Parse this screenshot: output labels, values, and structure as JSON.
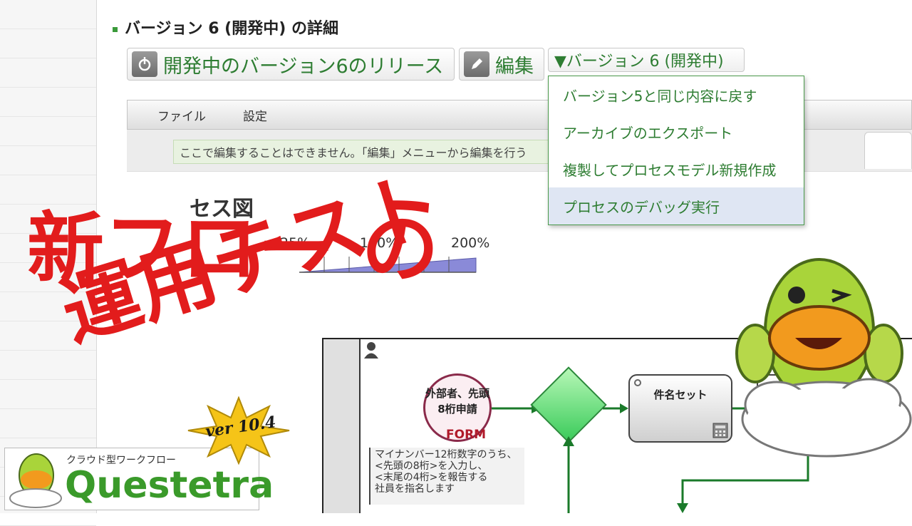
{
  "section": {
    "title": "バージョン 6 (開発中) の詳細"
  },
  "toolbar": {
    "release_label": "開発中のバージョン6のリリース",
    "edit_label": "編集",
    "version_select": "▼バージョン 6 (開発中)"
  },
  "version_menu": {
    "items": [
      {
        "label": "バージョン5と同じ内容に戻す"
      },
      {
        "label": "アーカイブのエクスポート"
      },
      {
        "label": "複製してプロセスモデル新規作成"
      },
      {
        "label": "プロセスのデバッグ実行"
      }
    ]
  },
  "menubar": {
    "file": "ファイル",
    "settings": "設定"
  },
  "notice": "ここで編集することはできません。「編集」メニューから編集を行う",
  "process_title": "セス図",
  "zoom": {
    "min": "25%",
    "mid": "100%",
    "max": "200%"
  },
  "diagram": {
    "form_node": "外部者、先頭8桁申請",
    "form_badge": "FORM",
    "task_node": "件名セット",
    "comment": [
      "マイナンバー12桁数字のうち、",
      "<先頭の8桁>を入力し、",
      "<末尾の4桁>を報告する",
      "社員を指名します"
    ]
  },
  "overlay": {
    "line1": "新フロー の",
    "line2": "運用テスト"
  },
  "logo": {
    "sub": "クラウド型ワークフロー",
    "main": "Questetra"
  },
  "badge": {
    "text": "ver 10.4"
  },
  "colors": {
    "accent_green": "#2e7d32",
    "overlay_red": "#e21c1c",
    "menu_highlight": "#dfe6f3"
  }
}
